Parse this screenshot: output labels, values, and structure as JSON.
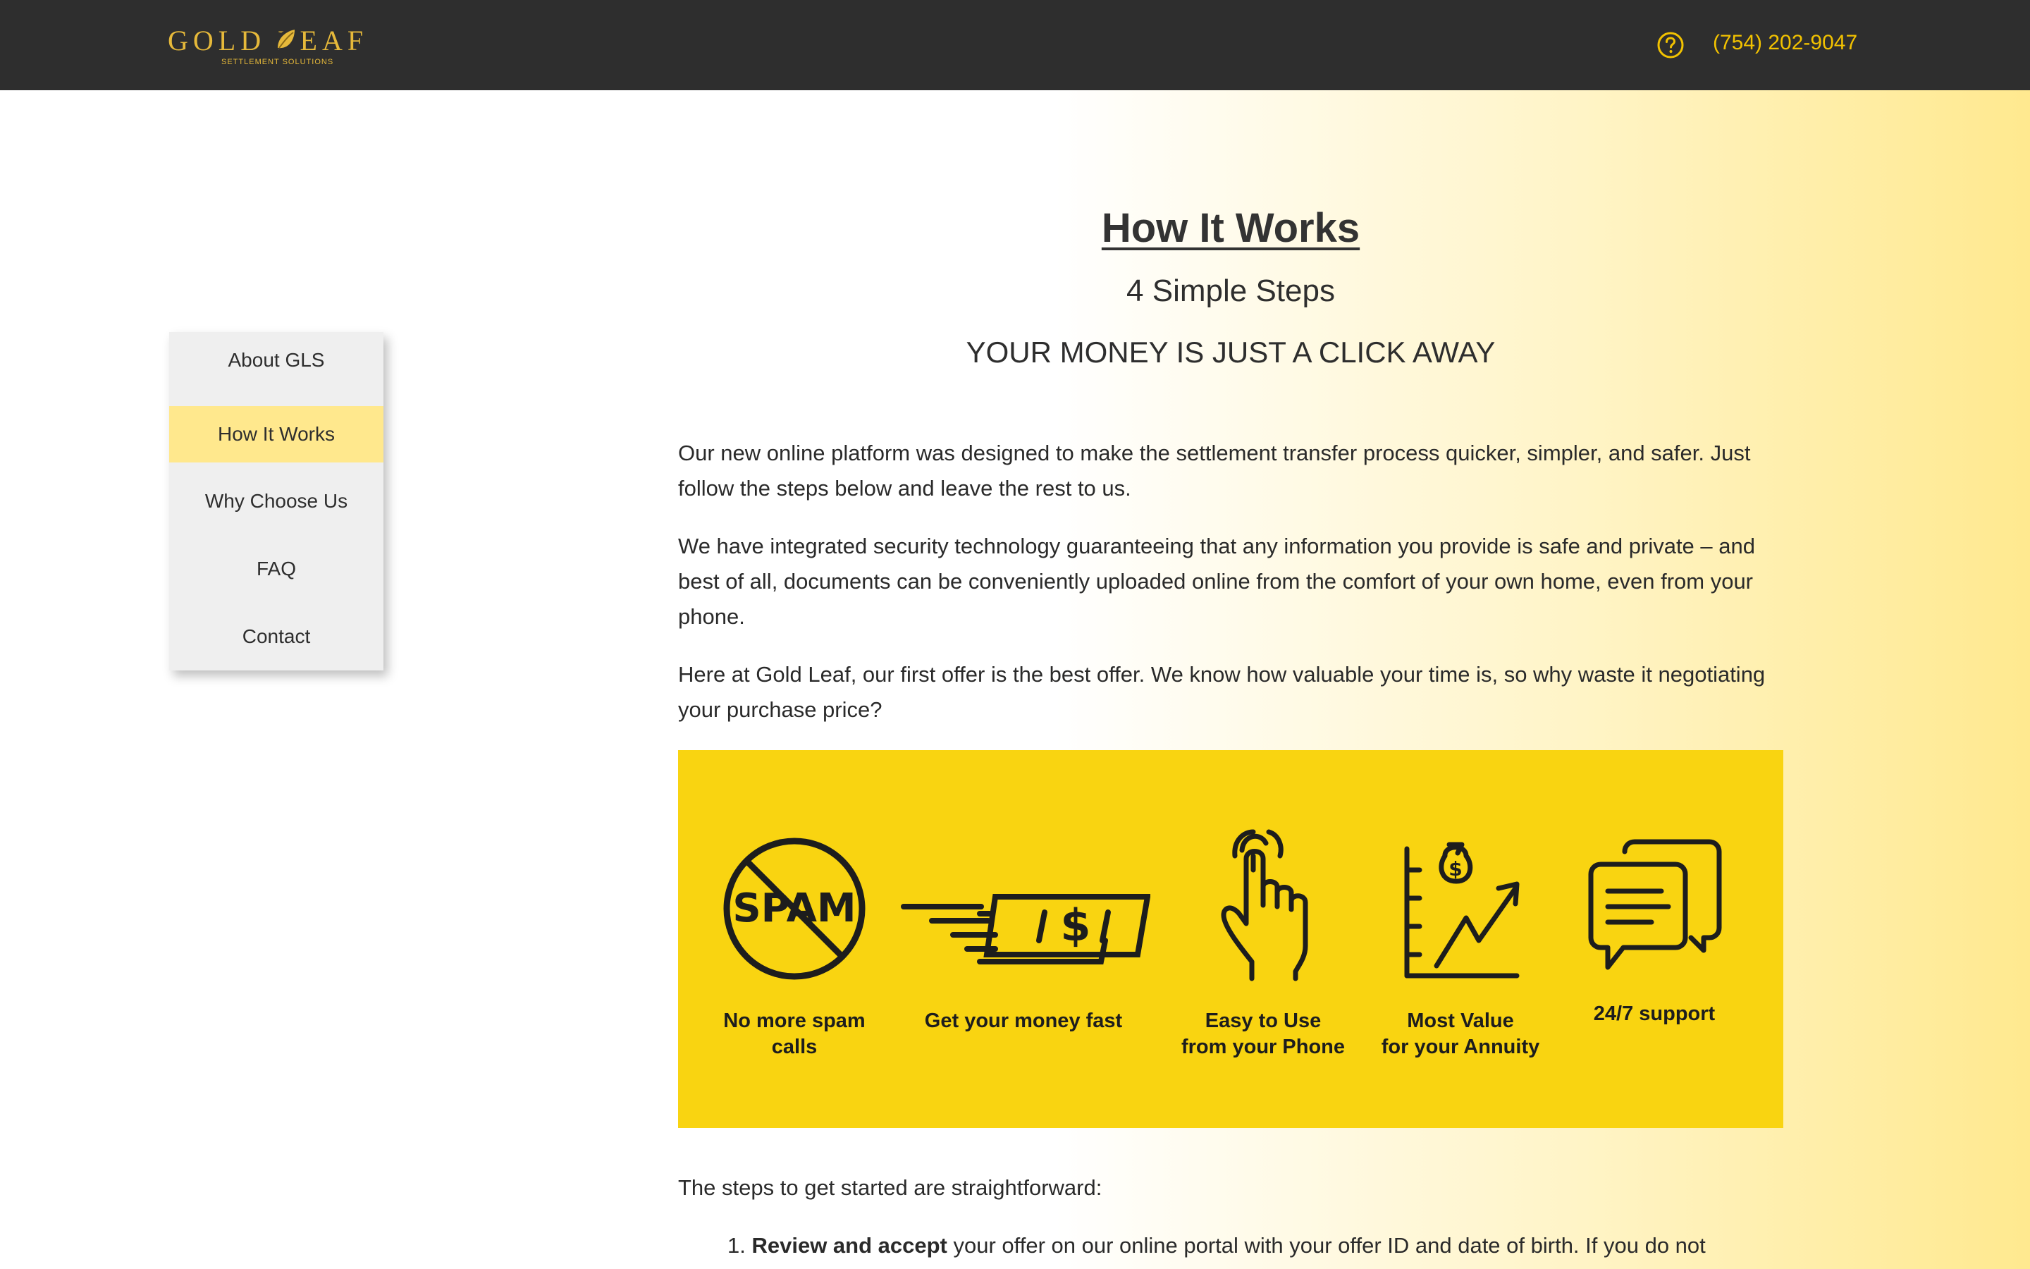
{
  "header": {
    "logo_text": "GOLD LEAF",
    "logo_subtitle": "SETTLEMENT SOLUTIONS",
    "help_icon": "question-circle-icon",
    "phone": "(754) 202-9047"
  },
  "sidebar": {
    "items": [
      {
        "label": "About GLS",
        "active": false
      },
      {
        "label": "How It Works",
        "active": true
      },
      {
        "label": "Why Choose Us",
        "active": false
      },
      {
        "label": "FAQ",
        "active": false
      },
      {
        "label": "Contact",
        "active": false
      }
    ]
  },
  "main": {
    "title": "How It Works",
    "subtitle": "4 Simple Steps",
    "tagline": "YOUR MONEY IS JUST A CLICK AWAY",
    "paragraphs": [
      "Our new online platform was designed to make the settlement transfer process quicker, simpler, and safer. Just follow the steps below and leave the rest to us.",
      "We have integrated security technology guaranteeing that any information you provide is safe and private – and best of all, documents can be conveniently uploaded online from the comfort of your own home, even from your phone.",
      "Here at Gold Leaf, our first offer is the best offer. We know how valuable your time is, so why waste it negotiating your purchase price?"
    ],
    "features": [
      {
        "label": "No more spam calls",
        "icon": "no-spam-icon"
      },
      {
        "label": "Get your money fast",
        "icon": "fast-money-icon"
      },
      {
        "label": "Easy to Use\nfrom your Phone",
        "icon": "tap-hand-icon"
      },
      {
        "label": "Most Value\nfor your Annuity",
        "icon": "growth-chart-icon"
      },
      {
        "label": "24/7 support",
        "icon": "chat-bubbles-icon"
      }
    ],
    "banner_spam_text": "SPAM",
    "steps_intro": "The steps to get started are straightforward:",
    "step1_number": "1.",
    "step1_bold": "Review and accept",
    "step1_rest": " your offer on our online portal with your offer ID and date of birth. If you do not"
  },
  "colors": {
    "header_bg": "#2e2e2e",
    "brand_gold": "#e6b93a",
    "phone_yellow": "#f2c200",
    "nav_active": "#ffe88d",
    "banner_yellow": "#f9d411"
  }
}
